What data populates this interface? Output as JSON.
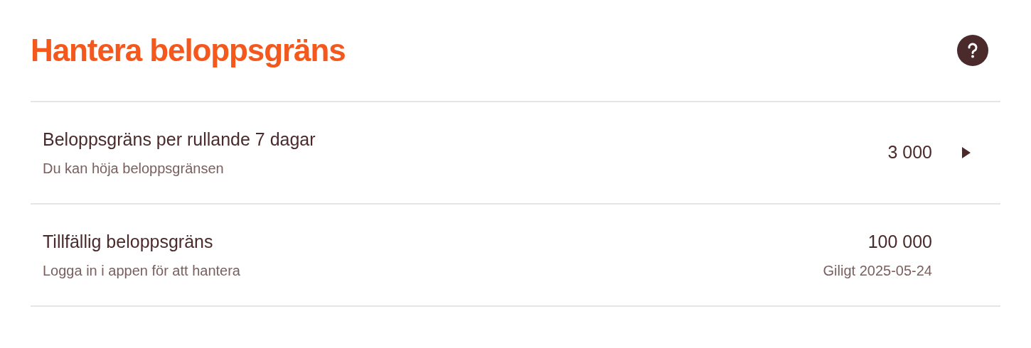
{
  "title": "Hantera beloppsgräns",
  "rows": [
    {
      "kind": "link",
      "label": "Beloppsgräns per rullande 7 dagar",
      "sublabel": "Du kan höja beloppsgränsen",
      "value": "3 000"
    },
    {
      "kind": "info",
      "label": "Tillfällig beloppsgräns",
      "sublabel": "Logga in i appen för att hantera",
      "value": "100 000",
      "note": "Giligt 2025-05-24"
    }
  ]
}
